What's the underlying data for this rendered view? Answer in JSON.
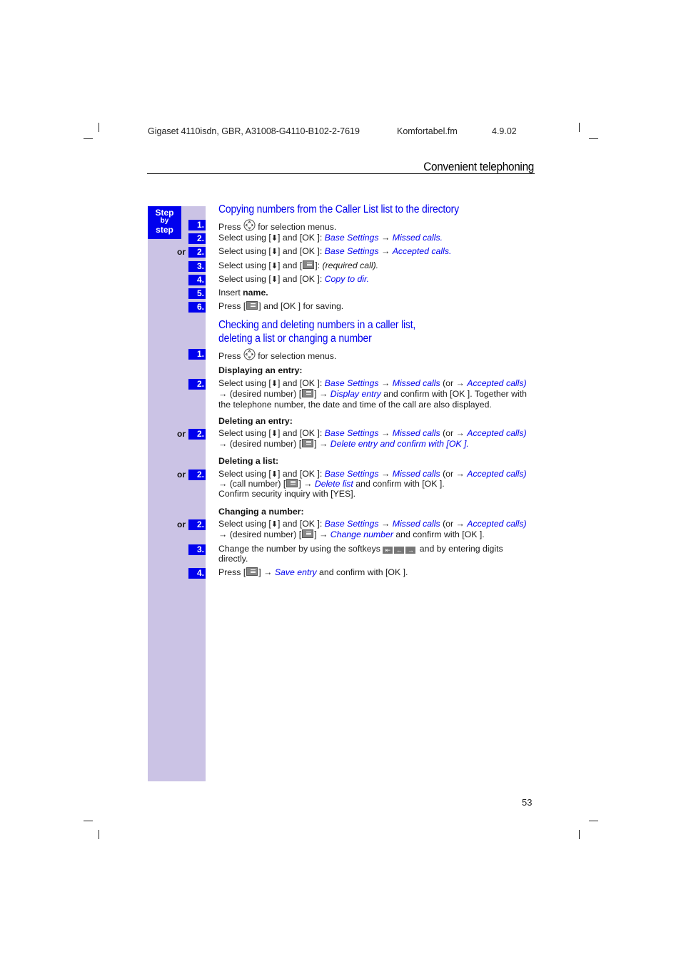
{
  "header": {
    "doc_id": "Gigaset 4110isdn, GBR, A31008-G4110-B102-2-7619",
    "file": "Komfortabel.fm",
    "date": "4.9.02",
    "section_title": "Convenient telephoning"
  },
  "sidebar": {
    "badge": {
      "line1": "Step",
      "line2": "by",
      "line3": "step"
    },
    "or_label": "or"
  },
  "icons": {
    "nav_key": "navigation-key-icon",
    "down_key": "down-arrow-key-icon",
    "menu_key": "menu-key-icon",
    "arrow": "→"
  },
  "section1": {
    "title": "Copying numbers from the Caller List list to the directory",
    "steps": [
      {
        "num": "1.",
        "or": false,
        "pre": "Press",
        "post": "for selection menus."
      },
      {
        "num": "2.",
        "or": false,
        "pre": "Select using [",
        "mid": "] and [OK ]: ",
        "link1": "Base Settings",
        "arrow": " → ",
        "link2": "Missed calls",
        "end": "."
      },
      {
        "num": "2.",
        "or": true,
        "pre": "Select using [",
        "mid": "] and [OK ]: ",
        "link1": "Base Settings",
        "arrow": " → ",
        "link2": "Accepted calls",
        "end": "."
      },
      {
        "num": "3.",
        "or": false,
        "pre": "Select using [",
        "mid": "] and [",
        "mid2": "]: ",
        "italic": "(required call)",
        "end": "."
      },
      {
        "num": "4.",
        "or": false,
        "pre": "Select using [",
        "mid": "] and [OK ]: ",
        "link1": "Copy to dir."
      },
      {
        "num": "5.",
        "or": false,
        "pre": "Insert ",
        "bold": "name."
      },
      {
        "num": "6.",
        "or": false,
        "pre": "Press [",
        "mid": "] and [OK ] for saving."
      }
    ]
  },
  "section2": {
    "title_line1": "Checking and deleting numbers in a caller list,",
    "title_line2": "deleting a list or changing a number",
    "step1": {
      "num": "1.",
      "pre": "Press",
      "post": "for selection menus."
    },
    "displaying": {
      "subhead": "Displaying an entry:",
      "num": "2.",
      "l1_pre": "Select using [",
      "l1_mid": "] and [OK ]: ",
      "base": "Base Settings",
      "arrow": " → ",
      "missed": "Missed calls",
      "or_open": " (or → ",
      "accepted": "Accepted calls)",
      "l2_pre": "→ (desired number) [",
      "l2_mid": "] → ",
      "l2_link": "Display entry",
      "l2_post": " and confirm with [OK ]. Together with",
      "l3": "the telephone number, the date and time of the call are also displayed."
    },
    "deleting_entry": {
      "subhead": "Deleting an entry:",
      "num": "2.",
      "l2_pre": "→ (desired number) [",
      "l2_mid": "] → ",
      "l2_link": "Delete entry and confirm with [OK ]."
    },
    "deleting_list": {
      "subhead": "Deleting a list:",
      "num": "2.",
      "l2_pre": "→ (call number) [",
      "l2_mid": "] → ",
      "l2_link": "Delete list",
      "l2_post": " and confirm with [OK ].",
      "l3": "Confirm security inquiry with [YES]."
    },
    "changing": {
      "subhead": "Changing a number:",
      "num": "2.",
      "l2_pre": "→ (desired number) [",
      "l2_mid": "] → ",
      "l2_link": "Change number",
      "l2_post": " and confirm with [OK ].",
      "step3_num": "3.",
      "step3_pre": "Change the number by using the softkeys",
      "softkeys": [
        "⇤",
        "←",
        "→"
      ],
      "step3_post": " and by entering digits",
      "step3_l2": "directly.",
      "step4_num": "4.",
      "step4_pre": "Press [",
      "step4_mid": "] → ",
      "step4_link": "Save entry",
      "step4_post": " and confirm with [OK ]."
    },
    "select_pre": "Select using [",
    "select_mid": "] and [OK ]: "
  },
  "footer": {
    "page_number": "53"
  }
}
